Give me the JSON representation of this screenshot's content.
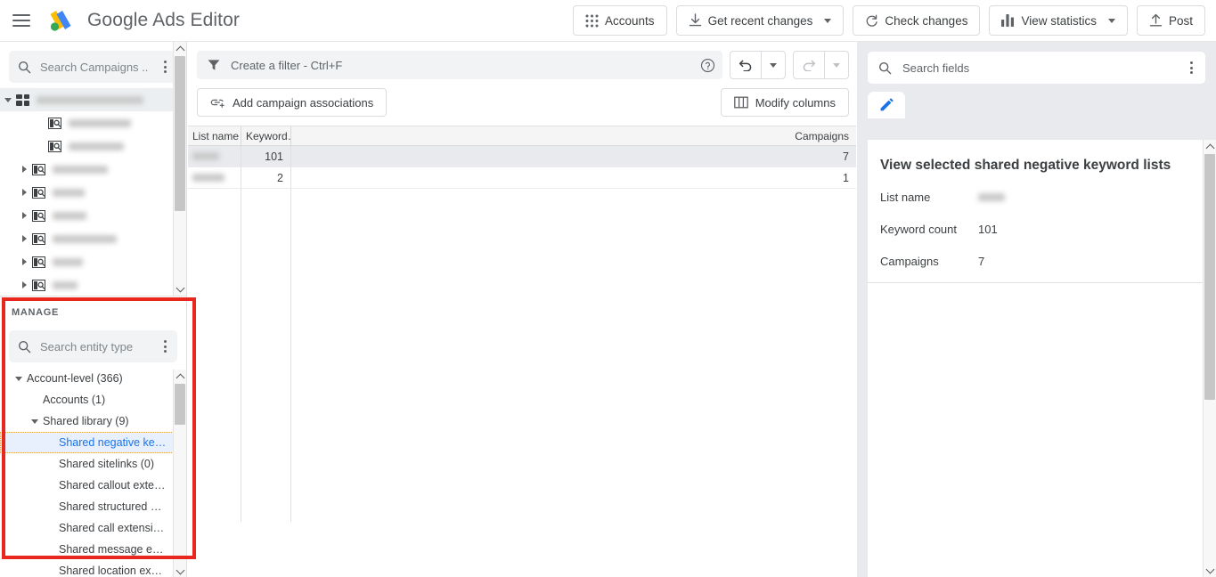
{
  "app": {
    "title_bold": "Google",
    "title_rest": " Ads Editor",
    "menu_icon": "hamburger-icon",
    "logo_icon": "google-ads-logo"
  },
  "toolbar": {
    "buttons": [
      {
        "label": "Accounts",
        "icon": "apps-grid-icon",
        "caret": false
      },
      {
        "label": "Get recent changes",
        "icon": "download-icon",
        "caret": true
      },
      {
        "label": "Check changes",
        "icon": "refresh-icon",
        "caret": false
      },
      {
        "label": "View statistics",
        "icon": "bar-chart-icon",
        "caret": true
      },
      {
        "label": "Post",
        "icon": "upload-icon",
        "caret": false
      }
    ]
  },
  "left_tree": {
    "search_placeholder": "Search Campaigns ...",
    "search_icon": "search-icon",
    "kebab_icon": "more-vert-icon",
    "root": {
      "label": "",
      "redacted": true,
      "icon": "apps-grid-icon",
      "expanded": true,
      "width": 120
    },
    "items": [
      {
        "indent": 2,
        "icon": "campaign-icon",
        "twisty": "none",
        "redacted": true,
        "width": 70
      },
      {
        "indent": 2,
        "icon": "campaign-icon",
        "twisty": "none",
        "redacted": true,
        "width": 62
      },
      {
        "indent": 1,
        "icon": "adgroup-icon",
        "twisty": "right",
        "redacted": true,
        "width": 62
      },
      {
        "indent": 1,
        "icon": "adgroup-icon",
        "twisty": "right",
        "redacted": true,
        "width": 36
      },
      {
        "indent": 1,
        "icon": "adgroup-icon",
        "twisty": "right",
        "redacted": true,
        "width": 38
      },
      {
        "indent": 1,
        "icon": "adgroup-icon",
        "twisty": "right",
        "redacted": true,
        "width": 72
      },
      {
        "indent": 1,
        "icon": "adgroup-icon",
        "twisty": "right",
        "redacted": true,
        "width": 34
      },
      {
        "indent": 1,
        "icon": "adgroup-icon",
        "twisty": "right",
        "redacted": true,
        "width": 28
      },
      {
        "indent": 1,
        "icon": "adgroup-icon",
        "twisty": "right",
        "redacted": true,
        "width": 44
      }
    ]
  },
  "manage": {
    "section_label": "MANAGE",
    "search_placeholder": "Search entity type",
    "search_icon": "search-icon",
    "kebab_icon": "more-vert-icon",
    "items": [
      {
        "label": "Account-level (366)",
        "indent": 0,
        "twisty": "down",
        "selected": false
      },
      {
        "label": "Accounts (1)",
        "indent": 1,
        "twisty": "none",
        "selected": false
      },
      {
        "label": "Shared library (9)",
        "indent": 1,
        "twisty": "down",
        "selected": false
      },
      {
        "label": "Shared negative ke…",
        "indent": 2,
        "twisty": "none",
        "selected": true
      },
      {
        "label": "Shared sitelinks (0)",
        "indent": 2,
        "twisty": "none",
        "selected": false
      },
      {
        "label": "Shared callout exte…",
        "indent": 2,
        "twisty": "none",
        "selected": false
      },
      {
        "label": "Shared structured …",
        "indent": 2,
        "twisty": "none",
        "selected": false
      },
      {
        "label": "Shared call extensi…",
        "indent": 2,
        "twisty": "none",
        "selected": false
      },
      {
        "label": "Shared message e…",
        "indent": 2,
        "twisty": "none",
        "selected": false
      },
      {
        "label": "Shared location ex…",
        "indent": 2,
        "twisty": "none",
        "selected": false
      }
    ]
  },
  "filter": {
    "placeholder": "Create a filter - Ctrl+F",
    "filter_icon": "filter-icon",
    "help_icon": "help-circle-icon",
    "undo_icon": "undo-icon",
    "redo_icon": "redo-icon",
    "undo_enabled": true,
    "redo_enabled": false
  },
  "actions": {
    "add_associations_label": "Add campaign associations",
    "add_associations_icon": "link-add-icon",
    "modify_columns_label": "Modify columns",
    "modify_columns_icon": "columns-icon"
  },
  "table": {
    "columns": [
      "List name",
      "Keyword…",
      "Campaigns"
    ],
    "rows": [
      {
        "list_name": "",
        "redacted": true,
        "name_width": 30,
        "keyword_count": "101",
        "campaigns": "7",
        "selected": true
      },
      {
        "list_name": "",
        "redacted": true,
        "name_width": 36,
        "keyword_count": "2",
        "campaigns": "1",
        "selected": false
      }
    ]
  },
  "right_panel": {
    "search_placeholder": "Search fields",
    "search_icon": "search-icon",
    "kebab_icon": "more-vert-icon",
    "tab_icon": "edit-pencil-icon",
    "title": "View selected shared negative keyword lists",
    "fields": [
      {
        "label": "List name",
        "value": "",
        "redacted": true,
        "width": 30
      },
      {
        "label": "Keyword count",
        "value": "101",
        "redacted": false
      },
      {
        "label": "Campaigns",
        "value": "7",
        "redacted": false
      }
    ]
  },
  "colors": {
    "accent_blue": "#1a73e8",
    "selection_blue": "#e8f0fe",
    "focus_outline": "#e8a33d",
    "annotation_red": "#e8271f",
    "row_selected_grey": "#e8eaed",
    "panel_grey": "#e8eaed"
  }
}
